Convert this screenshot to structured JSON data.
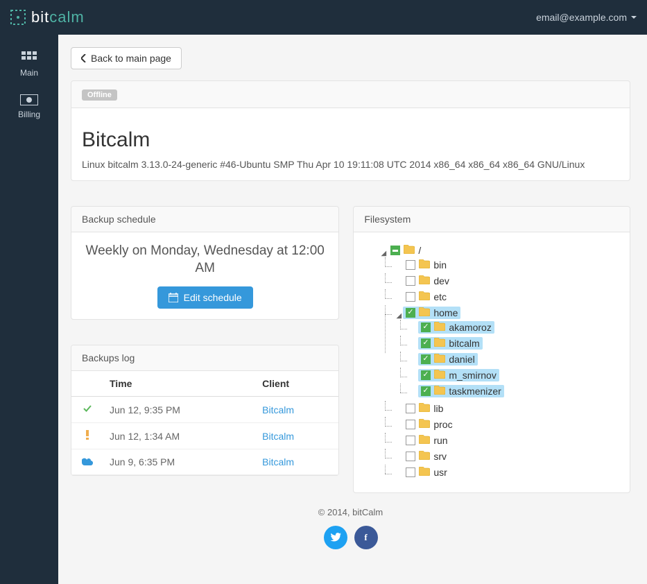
{
  "header": {
    "brand_a": "bit",
    "brand_b": "calm",
    "user_email": "email@example.com"
  },
  "sidebar": {
    "items": [
      {
        "label": "Main",
        "icon": "grid-icon"
      },
      {
        "label": "Billing",
        "icon": "money-icon"
      }
    ]
  },
  "back_button": "Back to main page",
  "server": {
    "status": "Offline",
    "name": "Bitcalm",
    "os": "Linux bitcalm 3.13.0-24-generic #46-Ubuntu SMP Thu Apr 10 19:11:08 UTC 2014 x86_64 x86_64 x86_64 GNU/Linux"
  },
  "schedule_panel": {
    "title": "Backup schedule",
    "description": "Weekly on Monday, Wednesday at 12:00 AM",
    "edit_button": "Edit schedule"
  },
  "logs_panel": {
    "title": "Backups log",
    "columns": {
      "time": "Time",
      "client": "Client"
    },
    "rows": [
      {
        "status": "success",
        "time": "Jun 12, 9:35 PM",
        "client": "Bitcalm"
      },
      {
        "status": "warning",
        "time": "Jun 12, 1:34 AM",
        "client": "Bitcalm"
      },
      {
        "status": "cloud",
        "time": "Jun 9, 6:35 PM",
        "client": "Bitcalm"
      }
    ]
  },
  "filesystem_panel": {
    "title": "Filesystem",
    "root": {
      "label": "/",
      "check": "partial",
      "expanded": true,
      "selected": false,
      "children": [
        {
          "label": "bin",
          "check": "none",
          "selected": false
        },
        {
          "label": "dev",
          "check": "none",
          "selected": false
        },
        {
          "label": "etc",
          "check": "none",
          "selected": false
        },
        {
          "label": "home",
          "check": "checked",
          "expanded": true,
          "selected": true,
          "children": [
            {
              "label": "akamoroz",
              "check": "checked",
              "selected": true
            },
            {
              "label": "bitcalm",
              "check": "checked",
              "selected": true
            },
            {
              "label": "daniel",
              "check": "checked",
              "selected": true
            },
            {
              "label": "m_smirnov",
              "check": "checked",
              "selected": true
            },
            {
              "label": "taskmenizer",
              "check": "checked",
              "selected": true
            }
          ]
        },
        {
          "label": "lib",
          "check": "none",
          "selected": false
        },
        {
          "label": "proc",
          "check": "none",
          "selected": false
        },
        {
          "label": "run",
          "check": "none",
          "selected": false
        },
        {
          "label": "srv",
          "check": "none",
          "selected": false
        },
        {
          "label": "usr",
          "check": "none",
          "selected": false
        }
      ]
    }
  },
  "footer": {
    "copyright": "© 2014, bitCalm"
  }
}
